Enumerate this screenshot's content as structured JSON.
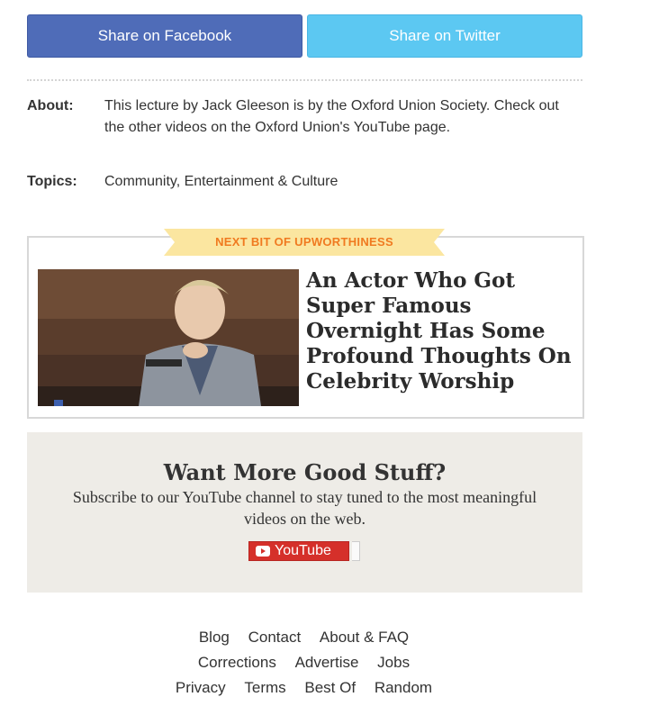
{
  "share": {
    "facebook_label": "Share on Facebook",
    "twitter_label": "Share on Twitter",
    "facebook_color": "#4f6cb8",
    "twitter_color": "#5cc8f2"
  },
  "meta": {
    "about_label": "About:",
    "about_text": "This lecture by Jack Gleeson is by the Oxford Union Society. Check out the other videos on the Oxford Union's YouTube page.",
    "topics_label": "Topics:",
    "topics_text": "Community, Entertainment & Culture"
  },
  "next": {
    "ribbon": "NEXT BIT OF UPWORTHINESS",
    "title": "An Actor Who Got Super Famous Overnight Has Some Profound Thoughts On Celebrity Worship",
    "ribbon_color": "#fbe6a0",
    "ribbon_text_color": "#f07a20"
  },
  "subscribe": {
    "title": "Want More Good Stuff?",
    "text": "Subscribe to our YouTube channel to stay tuned to the most meaningful videos on the web.",
    "button_label": "YouTube",
    "button_color": "#d5302a"
  },
  "footer": {
    "row1": [
      "Blog",
      "Contact",
      "About & FAQ"
    ],
    "row2": [
      "Corrections",
      "Advertise",
      "Jobs"
    ],
    "row3": [
      "Privacy",
      "Terms",
      "Best Of",
      "Random"
    ]
  }
}
